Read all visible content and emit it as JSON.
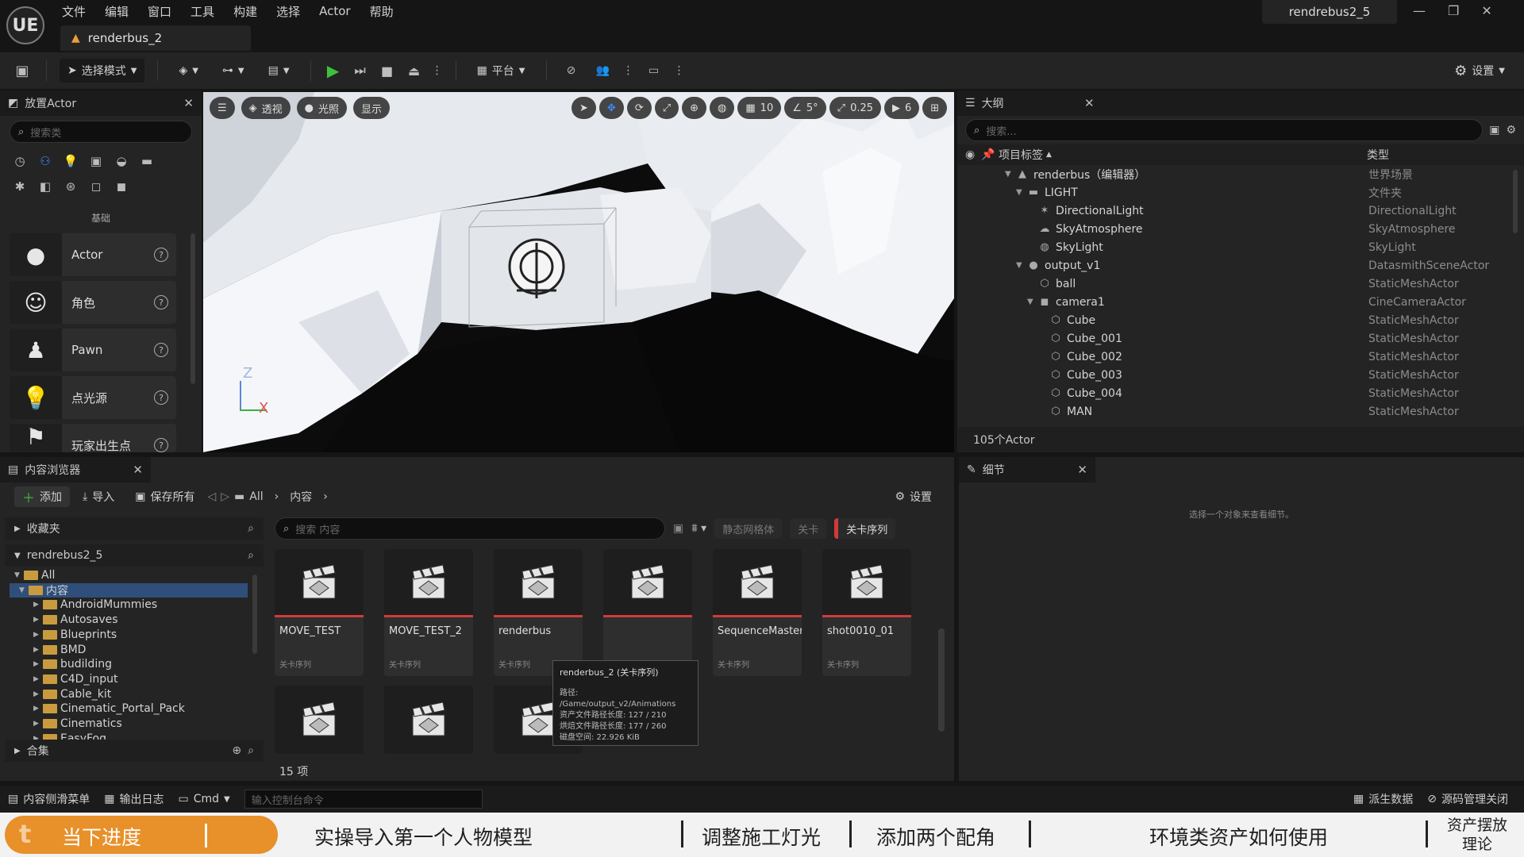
{
  "app": {
    "logo": "UE",
    "menu": [
      "文件",
      "编辑",
      "窗口",
      "工具",
      "构建",
      "选择",
      "Actor",
      "帮助"
    ],
    "doc_tab": "renderbus_2",
    "project_name": "rendrebus2_5",
    "window_controls": [
      "—",
      "❐",
      "✕"
    ]
  },
  "toolbar": {
    "select_mode": "选择模式",
    "platform": "平台",
    "settings": "设置"
  },
  "place_actor": {
    "title": "放置Actor",
    "search_placeholder": "搜索类",
    "category_label": "基础",
    "items": [
      {
        "label": "Actor",
        "icon": "sphere-icon"
      },
      {
        "label": "角色",
        "icon": "character-icon"
      },
      {
        "label": "Pawn",
        "icon": "pawn-icon"
      },
      {
        "label": "点光源",
        "icon": "point-light-icon"
      },
      {
        "label": "玩家出生点",
        "icon": "player-start-icon"
      }
    ]
  },
  "viewport": {
    "perspective": "透视",
    "lighting": "光照",
    "show": "显示",
    "grid_value": "10",
    "angle_value": "5°",
    "scale_value": "0.25",
    "camera_speed": "6",
    "axis_z": "Z",
    "axis_x": "X"
  },
  "outliner": {
    "title": "大纲",
    "search_placeholder": "搜索...",
    "col_label": "项目标签",
    "col_type": "类型",
    "rows": [
      {
        "indent": 1,
        "tri": "▼",
        "icon": "▲",
        "name": "renderbus（编辑器）",
        "type": "世界场景"
      },
      {
        "indent": 2,
        "tri": "▼",
        "icon": "▬",
        "name": "LIGHT",
        "type": "文件夹"
      },
      {
        "indent": 3,
        "tri": "",
        "icon": "✶",
        "name": "DirectionalLight",
        "type": "DirectionalLight"
      },
      {
        "indent": 3,
        "tri": "",
        "icon": "☁",
        "name": "SkyAtmosphere",
        "type": "SkyAtmosphere"
      },
      {
        "indent": 3,
        "tri": "",
        "icon": "◍",
        "name": "SkyLight",
        "type": "SkyLight"
      },
      {
        "indent": 2,
        "tri": "▼",
        "icon": "●",
        "name": "output_v1",
        "type": "DatasmithSceneActor"
      },
      {
        "indent": 3,
        "tri": "",
        "icon": "⬡",
        "name": "ball",
        "type": "StaticMeshActor"
      },
      {
        "indent": 3,
        "tri": "▼",
        "icon": "◼",
        "name": "camera1",
        "type": "CineCameraActor"
      },
      {
        "indent": 4,
        "tri": "",
        "icon": "⬡",
        "name": "Cube",
        "type": "StaticMeshActor"
      },
      {
        "indent": 4,
        "tri": "",
        "icon": "⬡",
        "name": "Cube_001",
        "type": "StaticMeshActor"
      },
      {
        "indent": 4,
        "tri": "",
        "icon": "⬡",
        "name": "Cube_002",
        "type": "StaticMeshActor"
      },
      {
        "indent": 4,
        "tri": "",
        "icon": "⬡",
        "name": "Cube_003",
        "type": "StaticMeshActor"
      },
      {
        "indent": 4,
        "tri": "",
        "icon": "⬡",
        "name": "Cube_004",
        "type": "StaticMeshActor"
      },
      {
        "indent": 4,
        "tri": "",
        "icon": "⬡",
        "name": "MAN",
        "type": "StaticMeshActor"
      }
    ],
    "count": "105个Actor"
  },
  "content_browser": {
    "title": "内容浏览器",
    "add": "添加",
    "import": "导入",
    "save_all": "保存所有",
    "path": [
      "All",
      "内容"
    ],
    "settings": "设置",
    "favorites": "收藏夹",
    "project_root": "rendrebus2_5",
    "tree": [
      {
        "label": "All",
        "indent": 0,
        "open": true
      },
      {
        "label": "内容",
        "indent": 1,
        "open": true,
        "selected": true
      },
      {
        "label": "AndroidMummies",
        "indent": 2
      },
      {
        "label": "Autosaves",
        "indent": 2
      },
      {
        "label": "Blueprints",
        "indent": 2
      },
      {
        "label": "BMD",
        "indent": 2
      },
      {
        "label": "budilding",
        "indent": 2
      },
      {
        "label": "C4D_input",
        "indent": 2
      },
      {
        "label": "Cable_kit",
        "indent": 2
      },
      {
        "label": "Cinematic_Portal_Pack",
        "indent": 2
      },
      {
        "label": "Cinematics",
        "indent": 2
      },
      {
        "label": "EasyFog",
        "indent": 2
      }
    ],
    "collections": "合集",
    "search_placeholder": "搜索 内容",
    "filters": [
      "静态网格体",
      "关卡",
      "关卡序列"
    ],
    "assets": [
      {
        "name": "MOVE_TEST",
        "type": "关卡序列"
      },
      {
        "name": "MOVE_TEST_2",
        "type": "关卡序列"
      },
      {
        "name": "renderbus",
        "type": "关卡序列"
      },
      {
        "name": "",
        "type": ""
      },
      {
        "name": "SequenceMaster",
        "type": "关卡序列"
      },
      {
        "name": "shot0010_01",
        "type": "关卡序列"
      }
    ],
    "tooltip": {
      "title": "renderbus_2 (关卡序列)",
      "lines": [
        "路径: /Game/output_v2/Animations",
        "资产文件路径长度: 127 / 210",
        "烘焙文件路径长度: 177 / 260",
        "磁盘空间: 22.926 KiB"
      ]
    },
    "item_count": "15 项"
  },
  "details": {
    "title": "细节",
    "empty_text": "选择一个对象来查看细节。"
  },
  "statusbar": {
    "drawer": "内容侧滑菜单",
    "output_log": "输出日志",
    "cmd": "Cmd",
    "console_placeholder": "输入控制台命令",
    "derived_data": "派生数据",
    "source_control": "源码管理关闭"
  },
  "banner": {
    "watermark": "t",
    "progress": "当下进度",
    "item1": "实操导入第一个人物模型",
    "item2": "调整施工灯光",
    "item3": "添加两个配角",
    "item4": "环境类资产如何使用",
    "item5a": "资产摆放",
    "item5b": "理论"
  }
}
